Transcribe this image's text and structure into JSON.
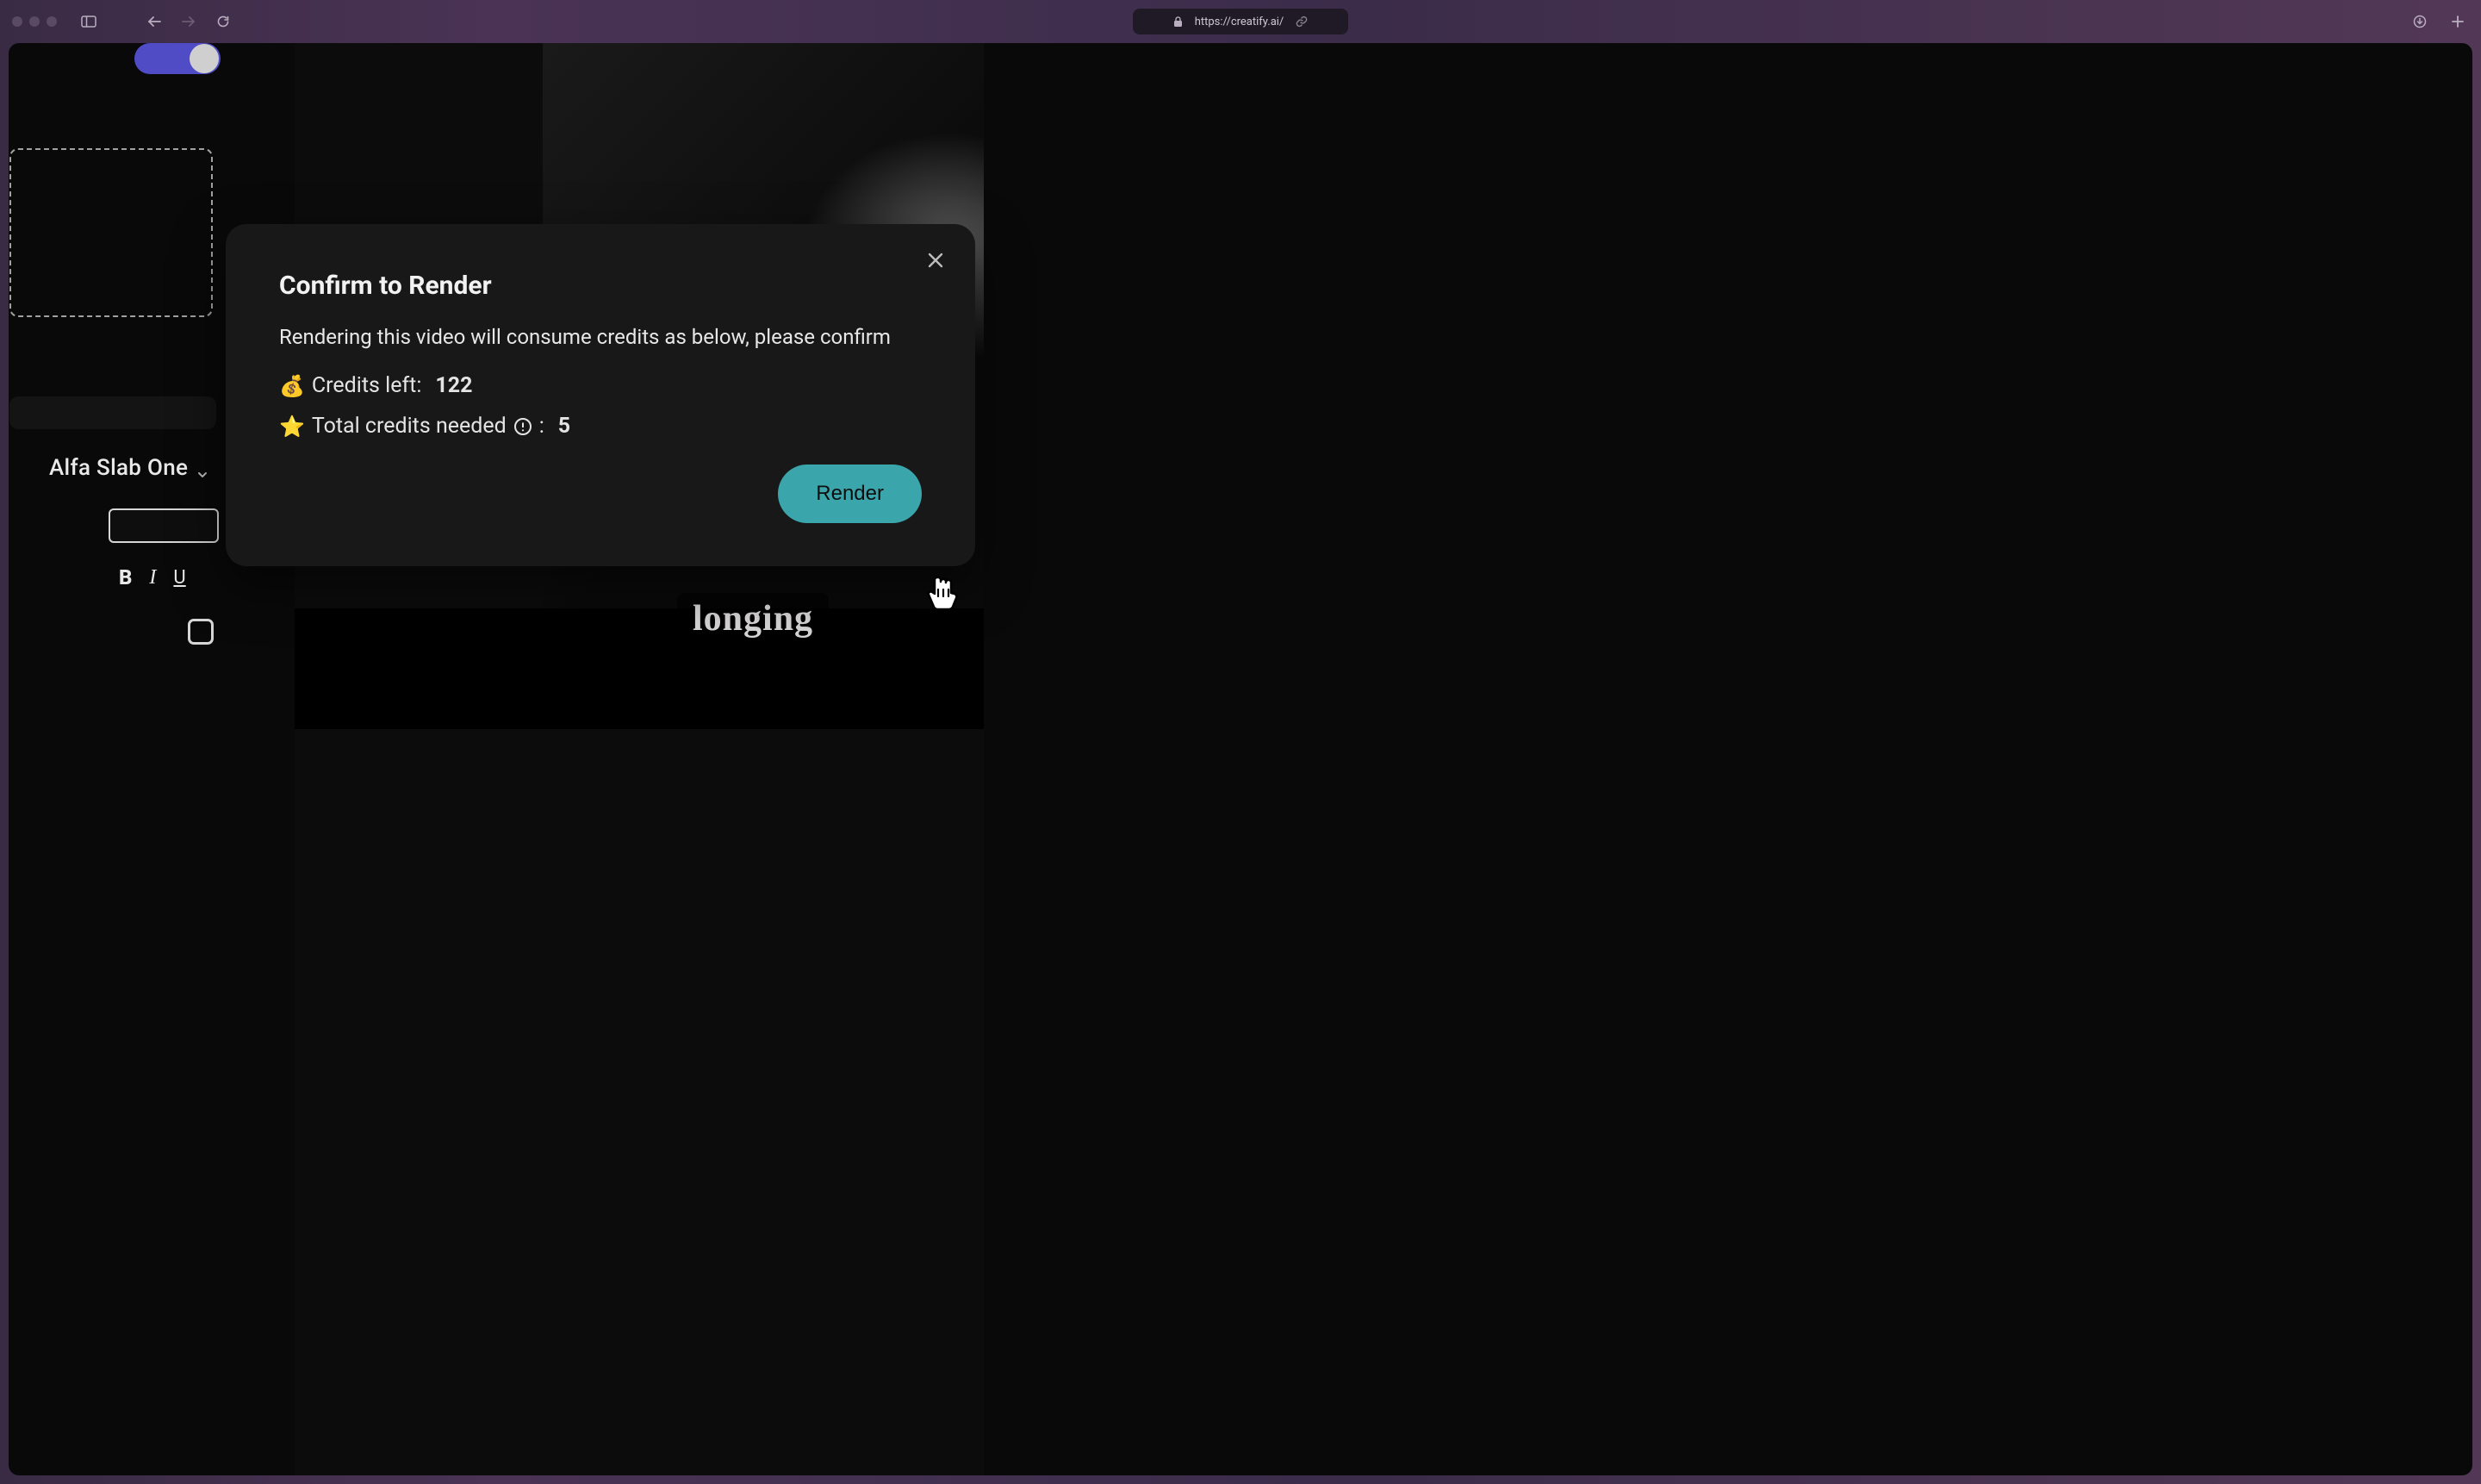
{
  "browser": {
    "url": "https://creatify.ai/"
  },
  "editor": {
    "font_name": "Alfa Slab One",
    "caption": "longing"
  },
  "modal": {
    "title": "Confirm to Render",
    "description": "Rendering this video will consume credits as below, please confirm",
    "credits_left_label": "Credits left:",
    "credits_left_value": "122",
    "credits_needed_label": "Total credits needed",
    "credits_needed_value": "5",
    "render_button": "Render"
  }
}
